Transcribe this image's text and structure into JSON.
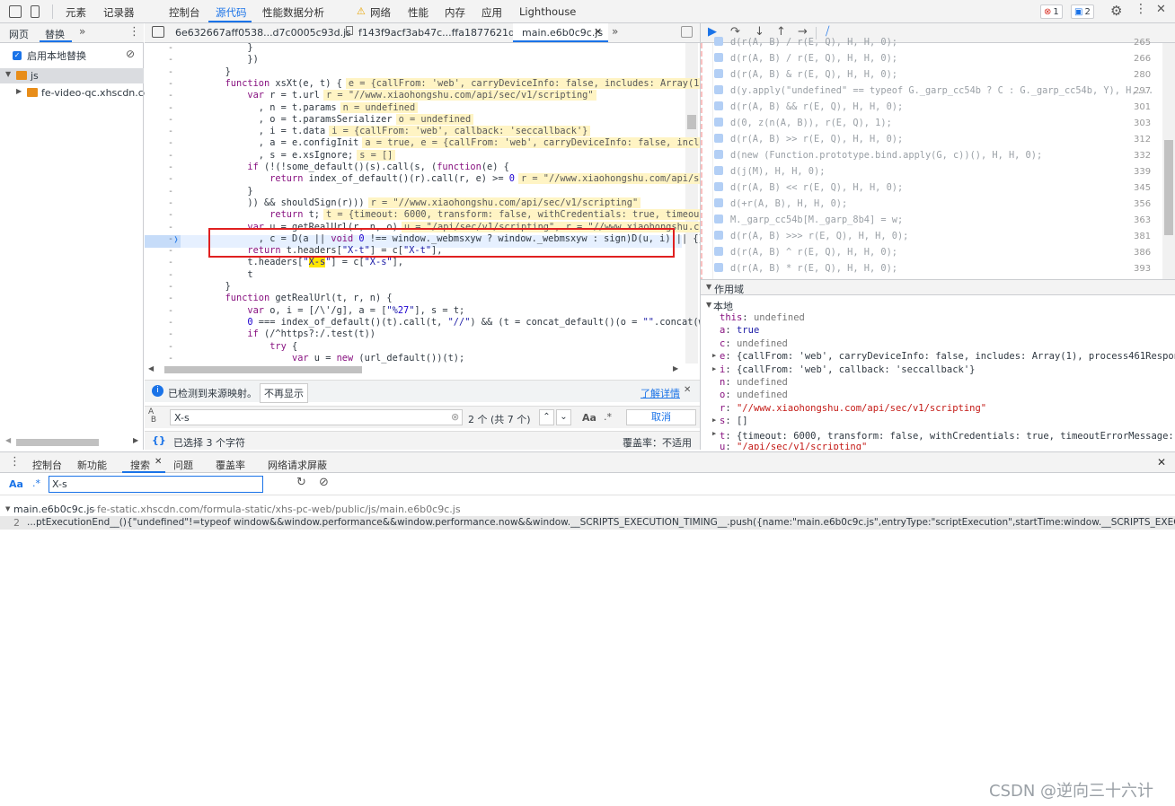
{
  "toolbar": {
    "tabs": [
      "元素",
      "记录器",
      "控制台",
      "源代码",
      "性能数据分析",
      "网络",
      "性能",
      "内存",
      "应用",
      "Lighthouse"
    ],
    "errors_count": "1",
    "messages_count": "2"
  },
  "navigator": {
    "tabs": [
      "网页",
      "替换"
    ],
    "enable_overrides_label": "启用本地替换",
    "tree": [
      "js",
      "fe-video-qc.xhscdn.com"
    ]
  },
  "editor": {
    "file_tabs": [
      "6e632667aff0538...d7c0005c93d.js",
      "f143f9acf3ab47c...ffa1877621d.js",
      "main.e6b0c9c.js"
    ],
    "source_map_notice": "已检测到来源映射。",
    "dont_show_again": "不再显示",
    "learn_more": "了解详情",
    "search_value": "X-s",
    "match_count": "2 个 (共 7 个)",
    "cancel_label": "取消",
    "status_selected": "已选择 3 个字符",
    "status_coverage": "覆盖率：不适用",
    "code_lines": [
      "            }",
      "            })",
      "        }",
      "        function xsXt(e, t) {",
      "            var r = t.url",
      "              , n = t.params",
      "              , o = t.paramsSerializer",
      "              , i = t.data",
      "              , a = e.configInit",
      "              , s = e.xsIgnore;",
      "            if (!(!some_default()(s).call(s, (function(e) {",
      "                return index_of_default()(r).call(r, e) >= 0",
      "            }",
      "            )) && shouldSign(r)))",
      "                return t;",
      "            var u = getRealUrl(r, n, o)",
      "              , c = D(a || void 0 !== window._webmsxyw ? window._webmsxyw : sign)D(u, i) || {};",
      "            return t.headers[\"X-t\"] = c[\"X-t\"],",
      "            t.headers[\"X-s\"] = c[\"X-s\"],",
      "            t",
      "        }",
      "        function getRealUrl(t, r, n) {",
      "            var o, i = [/\\'/g], a = [\"%27\"], s = t;",
      "            0 === index_of_default()(t).call(t, \"//\") && (t = concat_default()(o = \"\".concat(windo",
      "            if (/^https?:/.test(t))",
      "                try {",
      "                    var u = new (url_default())(t);"
    ],
    "inline_values": [
      "",
      "",
      "",
      "e = {callFrom: 'web', carryDeviceInfo: false, includes: Array(1),",
      "r = \"//www.xiaohongshu.com/api/sec/v1/scripting\"",
      "n = undefined",
      "o = undefined",
      "i = {callFrom: 'web', callback: 'seccallback'}",
      "a = true, e = {callFrom: 'web', carryDeviceInfo: false, include",
      "s = []",
      "",
      "r = \"//www.xiaohongshu.com/api/sec/",
      "",
      "r = \"//www.xiaohongshu.com/api/sec/v1/scripting\"",
      "t = {timeout: 6000, transform: false, withCredentials: true, timeoutEr",
      "u = \"/api/sec/v1/scripting\", r = \"//www.xiaohongshu.com/",
      "",
      "",
      "",
      "",
      "",
      "",
      "",
      "",
      "",
      "",
      ""
    ]
  },
  "breakpoints": [
    {
      "text": "d(r(A, B) / r(E, Q), H, H, 0);",
      "line": "265"
    },
    {
      "text": "d(r(A, B) / r(E, Q), H, H, 0);",
      "line": "266"
    },
    {
      "text": "d(r(A, B) & r(E, Q), H, H, 0);",
      "line": "280"
    },
    {
      "text": "d(y.apply(\"undefined\" == typeof G._garp_cc54b ? C : G._garp_cc54b, Y), H,...",
      "line": "297"
    },
    {
      "text": "d(r(A, B) && r(E, Q), H, H, 0);",
      "line": "301"
    },
    {
      "text": "d(0, z(n(A, B)), r(E, Q), 1);",
      "line": "303"
    },
    {
      "text": "d(r(A, B) >> r(E, Q), H, H, 0);",
      "line": "312"
    },
    {
      "text": "d(new (Function.prototype.bind.apply(G, c))(), H, H, 0);",
      "line": "332"
    },
    {
      "text": "d(j(M), H, H, 0);",
      "line": "339"
    },
    {
      "text": "d(r(A, B) << r(E, Q), H, H, 0);",
      "line": "345"
    },
    {
      "text": "d(+r(A, B), H, H, 0);",
      "line": "356"
    },
    {
      "text": "M._garp_cc54b[M._garp_8b4] = w;",
      "line": "363"
    },
    {
      "text": "d(r(A, B) >>> r(E, Q), H, H, 0);",
      "line": "381"
    },
    {
      "text": "d(r(A, B) ^ r(E, Q), H, H, 0);",
      "line": "386"
    },
    {
      "text": "d(r(A, B) * r(E, Q), H, H, 0);",
      "line": "393"
    }
  ],
  "scope": {
    "title": "作用域",
    "local_title": "本地",
    "vars": [
      {
        "k": "this",
        "v": "undefined"
      },
      {
        "k": "a",
        "v": "true"
      },
      {
        "k": "c",
        "v": "undefined"
      },
      {
        "k": "e",
        "v": "{callFrom: 'web', carryDeviceInfo: false, includes: Array(1), process461Response"
      },
      {
        "k": "i",
        "v": "{callFrom: 'web', callback: 'seccallback'}"
      },
      {
        "k": "n",
        "v": "undefined"
      },
      {
        "k": "o",
        "v": "undefined"
      },
      {
        "k": "r",
        "v": "\"//www.xiaohongshu.com/api/sec/v1/scripting\""
      },
      {
        "k": "s",
        "v": "[]"
      },
      {
        "k": "t",
        "v": "{timeout: 6000, transform: false, withCredentials: true, timeoutErrorMessage: '超"
      },
      {
        "k": "u",
        "v": "\"/api/sec/v1/scripting\""
      }
    ]
  },
  "drawer": {
    "tabs": [
      "控制台",
      "新功能",
      "搜索",
      "问题",
      "覆盖率",
      "网络请求屏蔽"
    ],
    "search_value": "X-s",
    "result_file": "main.e6b0c9c.js",
    "result_path": "fe-static.xhscdn.com/formula-static/xhs-pc-web/public/js/main.e6b0c9c.js",
    "result_line_no": "2",
    "result_text": "...ptExecutionEnd__(){\"undefined\"!=typeof window&&window.performance&&window.performance.now&&window.__SCRIPTS_EXECUTION_TIMING__.push({name:\"main.e6b0c9c.js\",entryType:\"scriptExecution\",startTime:window.__SCRIPTS_EXECUTION_START__[\"main.e6"
  },
  "watermark": "CSDN @逆向三十六计"
}
